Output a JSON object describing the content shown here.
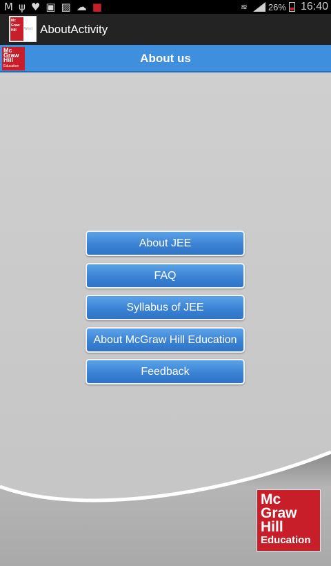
{
  "status_bar": {
    "battery_text": "26%",
    "time": "16:40",
    "left_icons": [
      "gmail-icon",
      "usb-icon",
      "location-icon",
      "task-icon",
      "image-icon",
      "weather-icon",
      "app-icon"
    ]
  },
  "action_bar": {
    "title": "AboutActivity",
    "app_icon_text": "Mc Graw Hill Education",
    "app_icon_word": "Word"
  },
  "header": {
    "title": "About us",
    "logo_lines": [
      "Mc",
      "Graw",
      "Hill"
    ],
    "logo_edu": "Education"
  },
  "menu": {
    "items": [
      {
        "label": "About JEE"
      },
      {
        "label": "FAQ"
      },
      {
        "label": "Syllabus of JEE"
      },
      {
        "label": "About McGraw Hill Education"
      },
      {
        "label": "Feedback"
      }
    ]
  },
  "brand_logo": {
    "lines": [
      "Mc",
      "Graw",
      "Hill"
    ],
    "edu": "Education"
  },
  "colors": {
    "header_blue": "#3f8fdf",
    "button_blue": "#3b82d4",
    "brand_red": "#c81e2a",
    "action_bar": "#232323"
  }
}
